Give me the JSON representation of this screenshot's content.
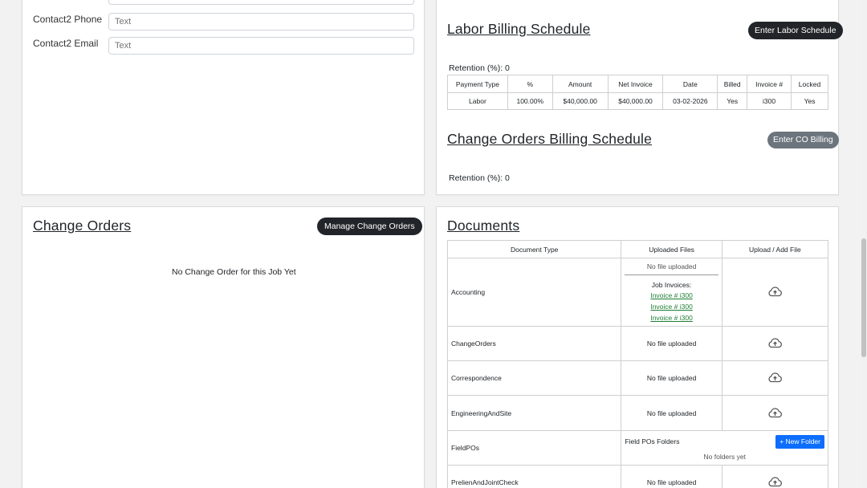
{
  "contact": {
    "fields": [
      {
        "label": "Contact2 Phone",
        "placeholder": "Text"
      },
      {
        "label": "Contact2 Email",
        "placeholder": "Text"
      }
    ]
  },
  "labor_billing": {
    "title": "Labor Billing Schedule",
    "button": "Enter Labor Schedule",
    "retention": "Retention (%): 0",
    "columns": [
      "Payment Type",
      "%",
      "Amount",
      "Net Invoice",
      "Date",
      "Billed",
      "Invoice #",
      "Locked"
    ],
    "rows": [
      [
        "Labor",
        "100.00%",
        "$40,000.00",
        "$40,000.00",
        "03-02-2026",
        "Yes",
        "i300",
        "Yes"
      ]
    ]
  },
  "co_billing": {
    "title": "Change Orders Billing Schedule",
    "button": "Enter CO Billing",
    "retention": "Retention (%): 0"
  },
  "change_orders": {
    "title": "Change Orders",
    "button": "Manage Change Orders",
    "empty": "No Change Order for this Job Yet"
  },
  "documents": {
    "title": "Documents",
    "columns": [
      "Document Type",
      "Uploaded Files",
      "Upload / Add File"
    ],
    "no_file": "No file uploaded",
    "job_invoices_label": "Job Invoices:",
    "invoice_links": [
      "Invoice # i300",
      "Invoice # i300",
      "Invoice # i300"
    ],
    "rows": [
      {
        "type": "Accounting"
      },
      {
        "type": "ChangeOrders"
      },
      {
        "type": "Correspondence"
      },
      {
        "type": "EngineeringAndSite"
      },
      {
        "type": "FieldPOs"
      },
      {
        "type": "PrelienAndJointCheck"
      }
    ],
    "field_pos": {
      "folders_label": "Field POs Folders",
      "new_folder": "+ New Folder",
      "no_folders": "No folders yet"
    },
    "upload_icon": "cloud-upload-icon"
  },
  "colors": {
    "dark_button": "#212529",
    "grey_button": "#6c757d",
    "blue_button": "#0d6efd",
    "link_green": "#1e7e34"
  }
}
